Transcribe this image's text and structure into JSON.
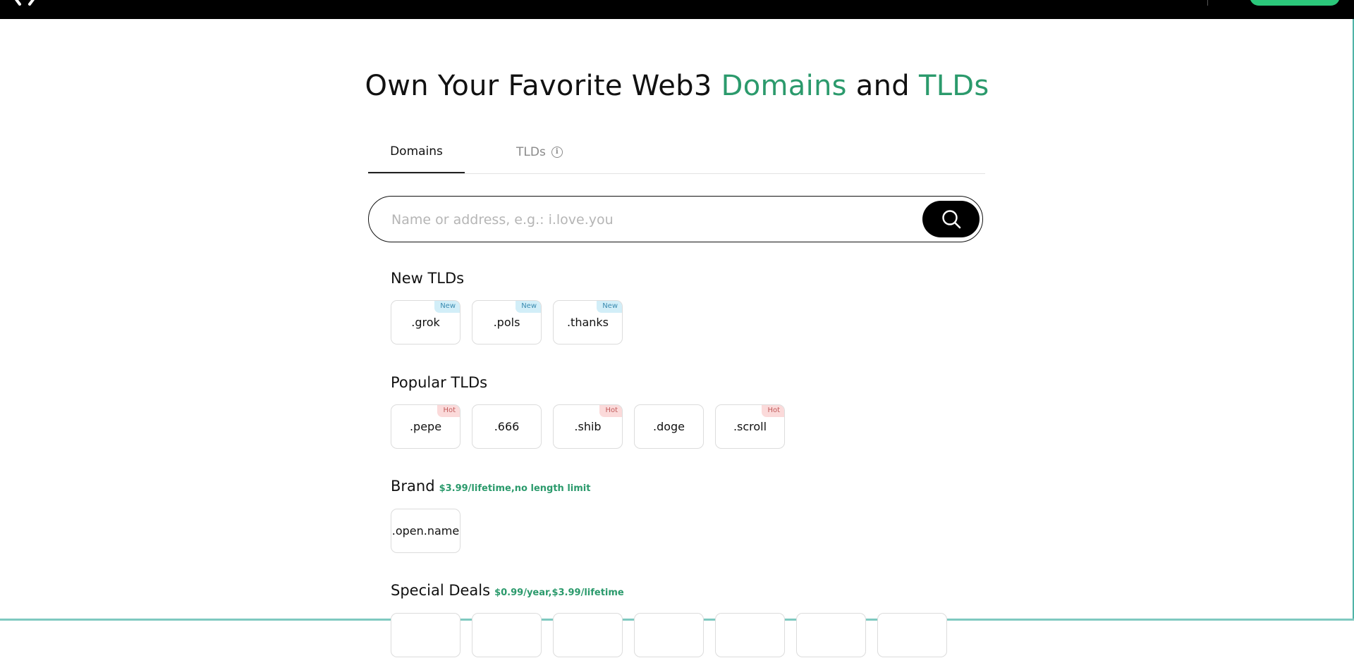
{
  "hero": {
    "part1": "Own Your Favorite Web3 ",
    "part2": "Domains",
    "part3": " and ",
    "part4": "TLDs"
  },
  "tabs": {
    "domains": "Domains",
    "tlds": "TLDs"
  },
  "search": {
    "placeholder": "Name or address, e.g.: i.love.you"
  },
  "sections": {
    "new_tlds": {
      "title": "New TLDs",
      "items": [
        {
          "label": ".grok",
          "badge": "New"
        },
        {
          "label": ".pols",
          "badge": "New"
        },
        {
          "label": ".thanks",
          "badge": "New"
        }
      ]
    },
    "popular_tlds": {
      "title": "Popular TLDs",
      "items": [
        {
          "label": ".pepe",
          "badge": "Hot"
        },
        {
          "label": ".666",
          "badge": ""
        },
        {
          "label": ".shib",
          "badge": "Hot"
        },
        {
          "label": ".doge",
          "badge": ""
        },
        {
          "label": ".scroll",
          "badge": "Hot"
        }
      ]
    },
    "brand": {
      "title": "Brand",
      "note": "$3.99/lifetime,no length limit",
      "items": [
        {
          "label": ".open.name",
          "badge": ""
        }
      ]
    },
    "special_deals": {
      "title": "Special Deals",
      "note": "$0.99/year,$3.99/lifetime"
    }
  },
  "colors": {
    "accent": "#2b9a6c",
    "new_badge_bg": "#d2eef8",
    "hot_badge_bg": "#fbdada",
    "cta_green": "#2bc77a"
  }
}
